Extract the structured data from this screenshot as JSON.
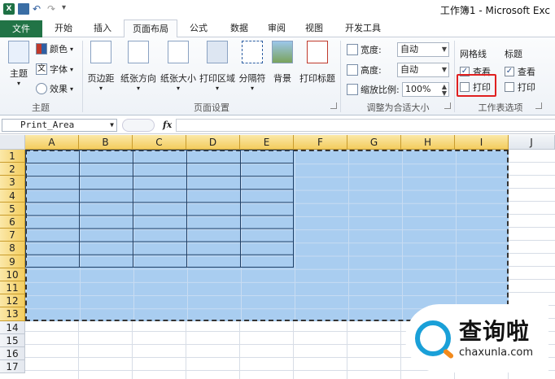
{
  "window": {
    "title": "工作簿1 - Microsoft Exc",
    "app_icon": "X"
  },
  "tabs": [
    {
      "label": "文件"
    },
    {
      "label": "开始"
    },
    {
      "label": "插入"
    },
    {
      "label": "页面布局"
    },
    {
      "label": "公式"
    },
    {
      "label": "数据"
    },
    {
      "label": "审阅"
    },
    {
      "label": "视图"
    },
    {
      "label": "开发工具"
    }
  ],
  "ribbon": {
    "theme_group": {
      "label": "主题",
      "theme_button": "主题",
      "colors": "颜色",
      "fonts": "字体",
      "effects": "效果"
    },
    "page_setup_group": {
      "label": "页面设置",
      "buttons": [
        "页边距",
        "纸张方向",
        "纸张大小",
        "打印区域",
        "分隔符",
        "背景",
        "打印标题"
      ]
    },
    "scale_group": {
      "label": "调整为合适大小",
      "width_label": "宽度:",
      "width_value": "自动",
      "height_label": "高度:",
      "height_value": "自动",
      "scale_label": "缩放比例:",
      "scale_value": "100%"
    },
    "sheet_options_group": {
      "label": "工作表选项",
      "gridlines_header": "网格线",
      "gridlines_view": "查看",
      "gridlines_print": "打印",
      "headings_header": "标题",
      "headings_view": "查看",
      "headings_print": "打印"
    }
  },
  "formula_bar": {
    "name_box": "Print_Area",
    "fx": "fx",
    "formula": ""
  },
  "sheet": {
    "columns": [
      "A",
      "B",
      "C",
      "D",
      "E",
      "F",
      "G",
      "H",
      "I",
      "J"
    ],
    "rows": [
      "1",
      "2",
      "3",
      "4",
      "5",
      "6",
      "7",
      "8",
      "9",
      "10",
      "11",
      "12",
      "13",
      "14",
      "15",
      "16",
      "17"
    ]
  },
  "watermark": {
    "brand": "查询啦",
    "url": "chaxunla.com"
  },
  "colors": {
    "file_tab": "#217346",
    "selection": "#a9cdf0",
    "highlight_box": "#e02020"
  }
}
